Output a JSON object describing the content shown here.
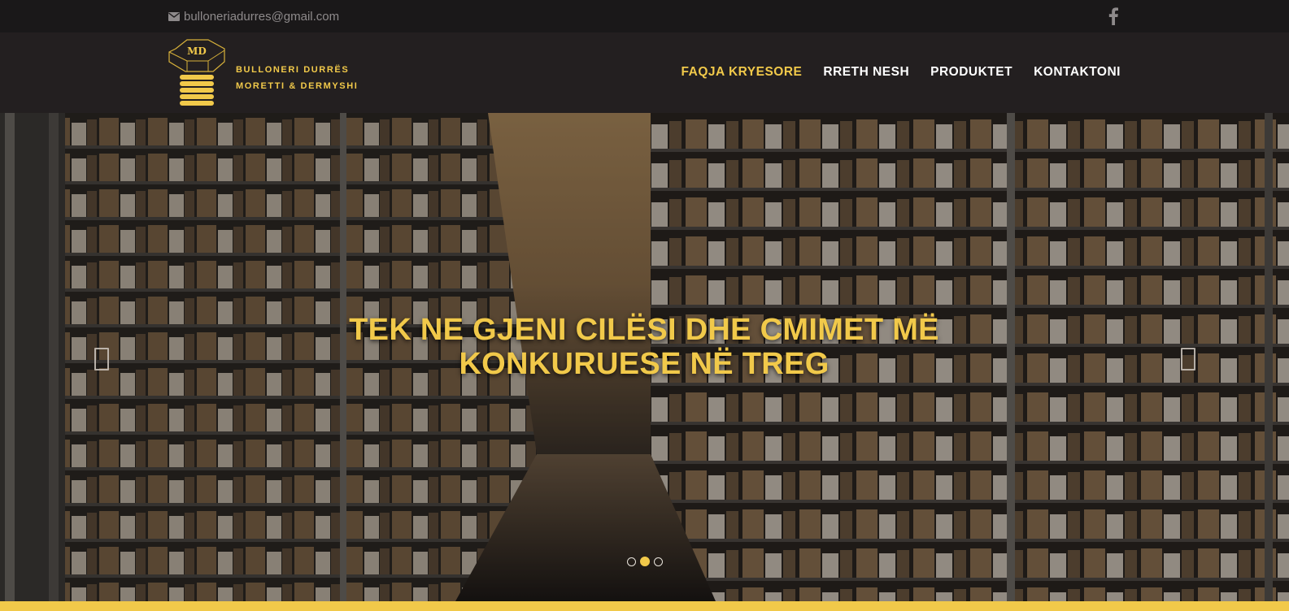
{
  "topbar": {
    "email": "bulloneriadurres@gmail.com",
    "email_icon": "envelope-icon",
    "social_icon": "facebook-icon"
  },
  "brand": {
    "logo_icon": "bolt-logo-icon",
    "line1": "BULLONERI DURRËS",
    "line2": "MORETTI & DERMYSHI"
  },
  "nav": {
    "items": [
      {
        "label": "FAQJA KRYESORE",
        "active": true
      },
      {
        "label": "RRETH NESH",
        "active": false
      },
      {
        "label": "PRODUKTET",
        "active": false
      },
      {
        "label": "KONTAKTONI",
        "active": false
      }
    ]
  },
  "hero": {
    "headline_line1": "TEK NE GJENI CILËSI DHE CMIMET MË",
    "headline_line2": "KONKURUESE NË TREG",
    "prev_icon": "chevron-left-icon",
    "next_icon": "chevron-right-icon",
    "slides_total": 3,
    "slide_active": 2
  },
  "colors": {
    "accent": "#f1c94a",
    "header_bg": "#231f20",
    "topbar_bg": "#1a1819",
    "nav_text": "#ffffff",
    "muted_text": "#8e8a8b"
  }
}
